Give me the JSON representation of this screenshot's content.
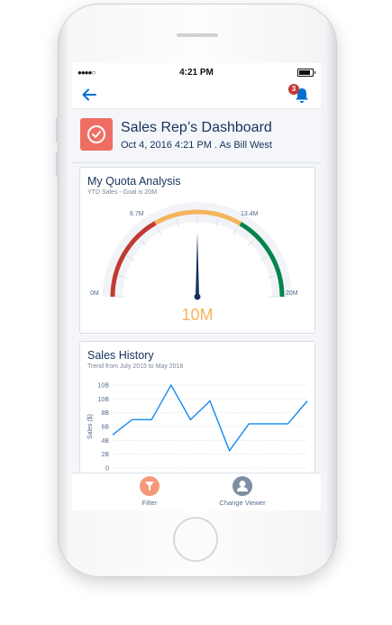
{
  "status_bar": {
    "signal": "●●●●○",
    "time": "4:21 PM"
  },
  "nav": {
    "notification_count": "3"
  },
  "dashboard": {
    "title": "Sales Rep’s Dashboard",
    "subtitle": "Oct 4, 2016 4:21 PM . As Bill West",
    "icon_color": "#ef6e64"
  },
  "quota_card": {
    "title": "My Quota Analysis",
    "subtitle": "YTD Sales - Goal is 20M",
    "labels": {
      "min": "0M",
      "low": "6.7M",
      "high": "13.4M",
      "max": "20M"
    },
    "value": "10M",
    "value_numeric": 10,
    "range": [
      0,
      20
    ],
    "bands": [
      {
        "from": 0,
        "to": 6.7,
        "color": "#c23934"
      },
      {
        "from": 6.7,
        "to": 13.4,
        "color": "#f4b45c"
      },
      {
        "from": 13.4,
        "to": 20,
        "color": "#04844b"
      }
    ]
  },
  "chart_data": {
    "type": "line",
    "title": "Sales History",
    "subtitle": "Trend from July 2015 to May 2016",
    "ylabel": "Sales ($)",
    "y_ticks": [
      "0",
      "2B",
      "4B",
      "6B",
      "8B",
      "10B",
      "10B"
    ],
    "ylim": [
      0,
      12
    ],
    "line_color": "#1589ee",
    "grid": true,
    "series": [
      {
        "values": [
          4.8,
          7,
          7,
          12,
          7,
          9.7,
          2.5,
          6.4,
          6.4,
          6.4,
          9.7
        ]
      }
    ]
  },
  "tabbar": {
    "filter_label": "Filter",
    "viewer_label": "Change Viewer",
    "filter_color": "#f59a78",
    "viewer_color": "#7e8ea3"
  }
}
